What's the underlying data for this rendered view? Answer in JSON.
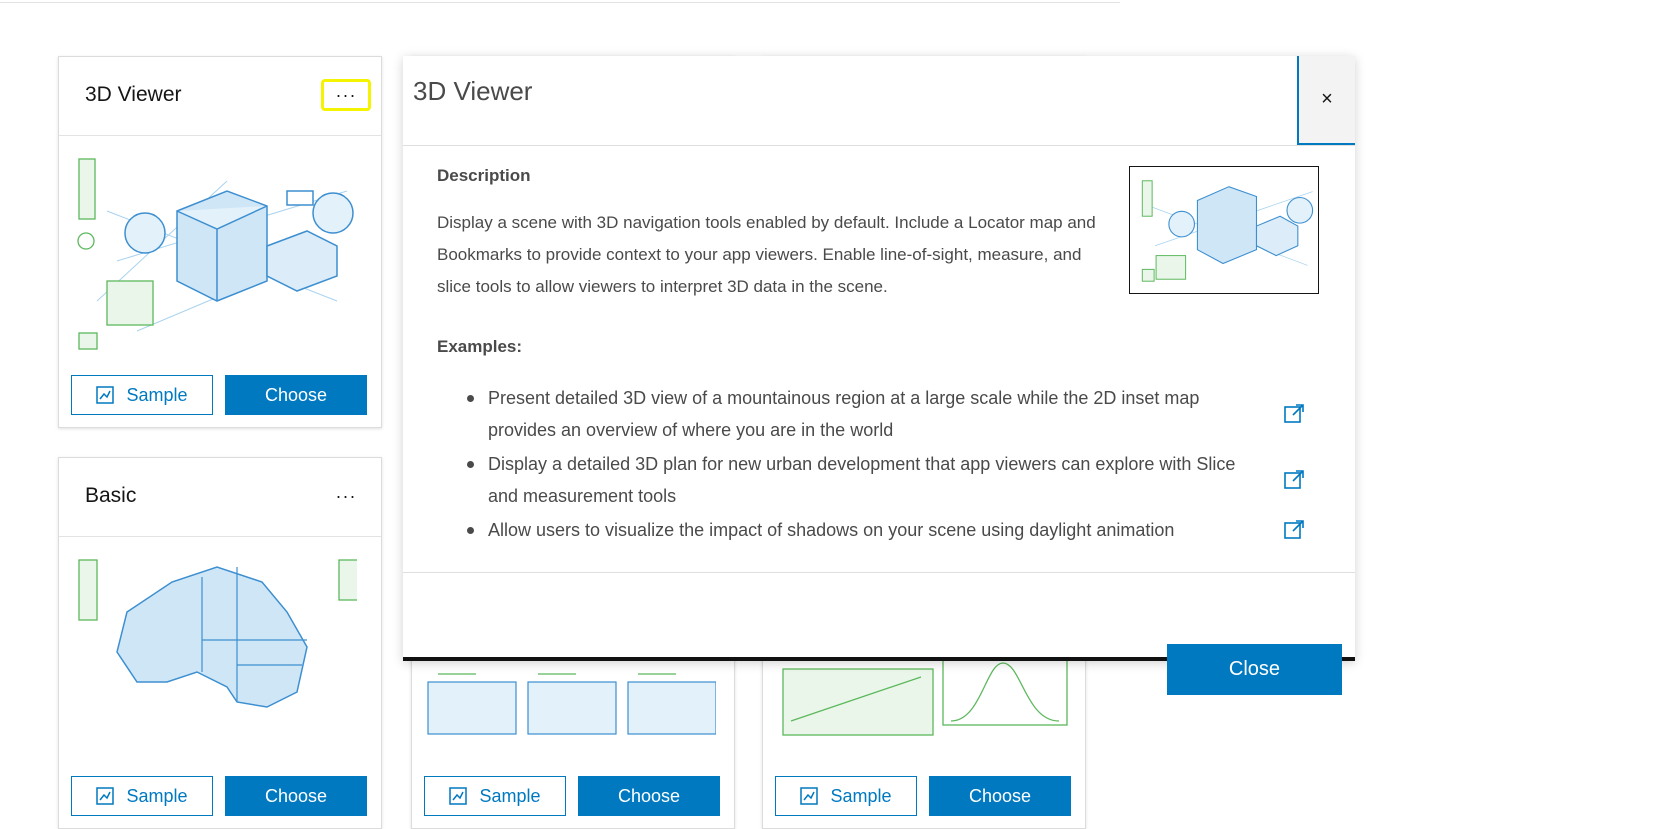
{
  "cards": [
    {
      "title": "3D Viewer",
      "menu": "···",
      "sample_label": "Sample",
      "choose_label": "Choose"
    },
    {
      "title": "Basic",
      "menu": "···",
      "sample_label": "Sample",
      "choose_label": "Choose"
    },
    {
      "sample_label": "Sample",
      "choose_label": "Choose"
    },
    {
      "sample_label": "Sample",
      "choose_label": "Choose"
    }
  ],
  "modal": {
    "title": "3D Viewer",
    "close_x": "×",
    "description_heading": "Description",
    "description": "Display a scene with 3D navigation tools enabled by default. Include a Locator map and Bookmarks to provide context to your app viewers. Enable line-of-sight, measure, and slice tools to allow viewers to interpret 3D data in the scene.",
    "examples_heading": "Examples:",
    "examples": [
      "Present detailed 3D view of a mountainous region at a large scale while the 2D inset map provides an overview of where you are in the world",
      "Display a detailed 3D plan for new urban development that app viewers can explore with Slice and measurement tools",
      "Allow users to visualize the impact of shadows on your scene using daylight animation"
    ],
    "close_label": "Close"
  },
  "colors": {
    "accent": "#0079c1",
    "highlight": "#f4f400",
    "illustration_blue": "#4a9fd8",
    "illustration_green": "#5cb85c"
  },
  "icons": [
    "more-icon",
    "sample-icon",
    "external-link-icon",
    "close-icon"
  ]
}
